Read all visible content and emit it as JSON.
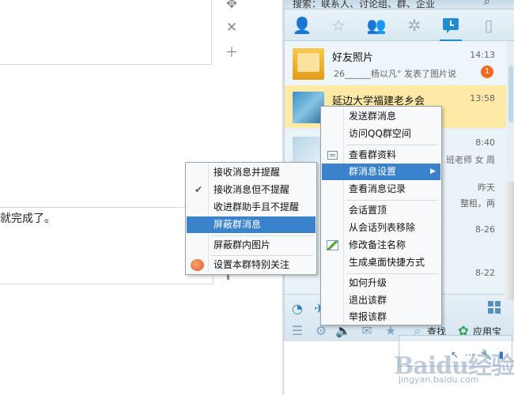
{
  "document": {
    "text": "就完成了。",
    "tool_icons": [
      "move-icon",
      "close-icon",
      "plus-icon"
    ]
  },
  "qq": {
    "search_placeholder": "搜索：联系人、讨论组、群、企业",
    "tabs": [
      "contacts-icon",
      "favorites-icon",
      "groups-icon",
      "apps-icon",
      "recent-chats-icon",
      "phone-icon"
    ],
    "conversations": [
      {
        "title": "好友照片",
        "time": "14:13",
        "subtitle": "26______杨以凡° 发表了图片说",
        "badge": "1"
      },
      {
        "title": "延边大学福建老乡会",
        "time": "13:58"
      }
    ],
    "partial_rows": [
      {
        "time": "8:40",
        "sub": "班老师 女 周"
      },
      {
        "time": "昨天",
        "sub": "整租，两"
      },
      {
        "time": "8-26",
        "sub": ""
      },
      {
        "time": "8-22",
        "sub": ""
      }
    ],
    "bottom": {
      "search_label": "查找",
      "app_label": "应用宝"
    }
  },
  "group_menu": {
    "items": [
      {
        "label": "发送群消息"
      },
      {
        "label": "访问QQ群空间"
      },
      {
        "label": "查看群资料"
      },
      {
        "label": "群消息设置"
      },
      {
        "label": "查看消息记录"
      },
      {
        "label": "会话置顶"
      },
      {
        "label": "从会话列表移除"
      },
      {
        "label": "修改备注名称"
      },
      {
        "label": "生成桌面快捷方式"
      },
      {
        "label": "如何升级"
      },
      {
        "label": "退出该群"
      },
      {
        "label": "举报该群"
      }
    ]
  },
  "msg_menu": {
    "items": [
      {
        "label": "接收消息并提醒"
      },
      {
        "label": "接收消息但不提醒"
      },
      {
        "label": "收进群助手且不提醒"
      },
      {
        "label": "屏蔽群消息"
      },
      {
        "label": "屏蔽群内图片"
      },
      {
        "label": "设置本群特别关注"
      }
    ]
  },
  "watermark": {
    "logo": "Baidu经验",
    "url": "jingyan.baidu.com"
  },
  "colors": {
    "highlight": "#3a82cc",
    "selected_row": "#ffe9a6",
    "badge": "#f06a23",
    "accent": "#1e8ccf"
  }
}
